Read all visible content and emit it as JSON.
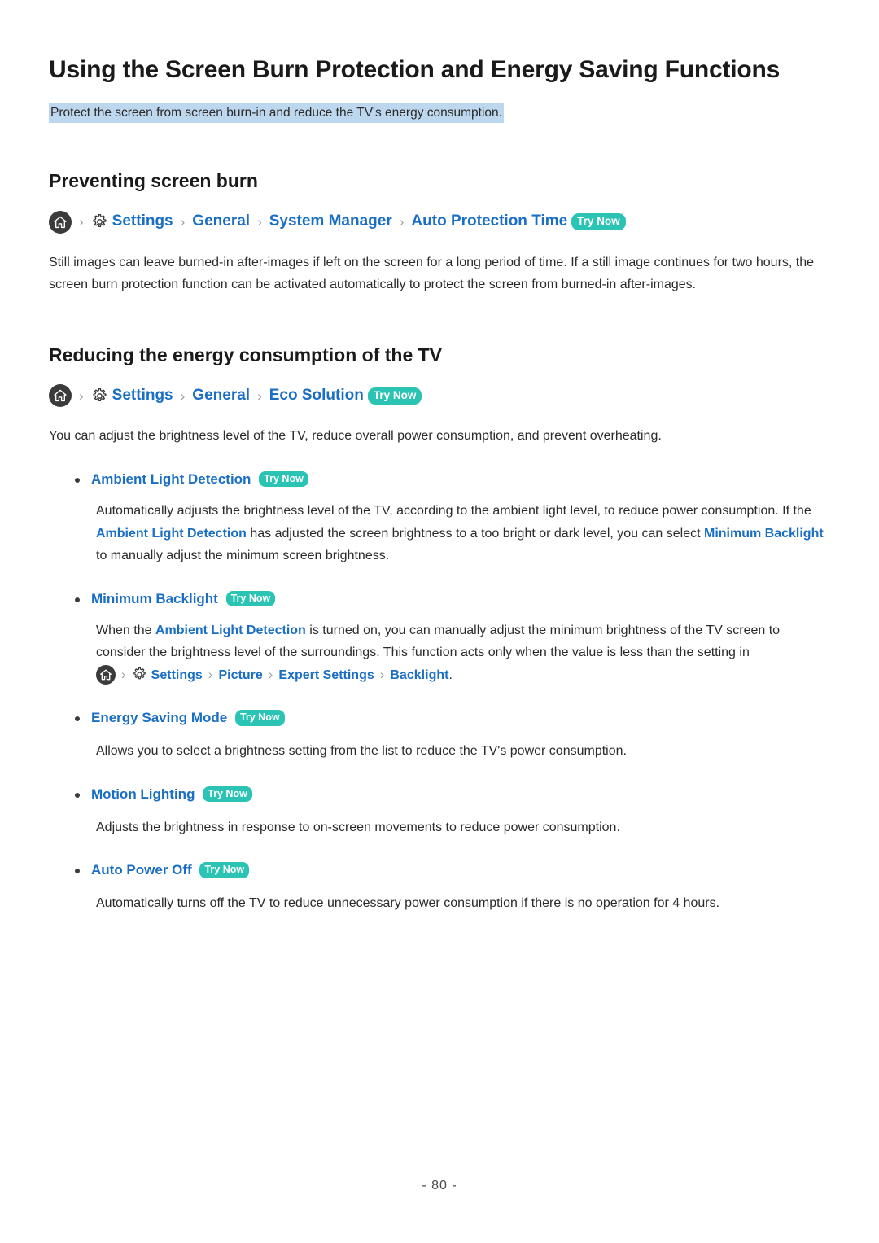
{
  "document": {
    "title": "Using the Screen Burn Protection and Energy Saving Functions",
    "subtitle": "Protect the screen from screen burn-in and reduce the TV's energy consumption.",
    "page_number": "- 80 -"
  },
  "colors": {
    "link_blue": "#1a6fc4",
    "try_now_teal": "#2bc4b4",
    "highlight_blue": "#bdd7ee",
    "icon_dark": "#3b3b3b",
    "body_text": "#2b2b2b"
  },
  "icons": {
    "home": "home-icon",
    "gear": "gear-icon",
    "chevron": "›",
    "bullet": "•"
  },
  "labels": {
    "try_now": "Try Now",
    "separator": "›"
  },
  "sections": [
    {
      "heading": "Preventing screen burn",
      "breadcrumb": {
        "items": [
          "Settings",
          "General",
          "System Manager",
          "Auto Protection Time"
        ],
        "badge": "Try Now"
      },
      "paragraph": "Still images can leave burned-in after-images if left on the screen for a long period of time. If a still image continues for two hours, the screen burn protection function can be activated automatically to protect the screen from burned-in after-images."
    },
    {
      "heading": "Reducing the energy consumption of the TV",
      "breadcrumb": {
        "items": [
          "Settings",
          "General",
          "Eco Solution"
        ],
        "badge": "Try Now"
      },
      "paragraph": "You can adjust the brightness level of the TV, reduce overall power consumption, and prevent overheating."
    }
  ],
  "bullets": [
    {
      "label": "Ambient Light Detection",
      "badge": "Try Now",
      "body_parts": {
        "p1": "Automatically adjusts the brightness level of the TV, according to the ambient light level, to reduce power consumption. If the ",
        "link1": "Ambient Light Detection",
        "p2": " has adjusted the screen brightness to a too bright or dark level, you can select ",
        "link2": "Minimum Backlight",
        "p3": " to manually adjust the minimum screen brightness."
      }
    },
    {
      "label": "Minimum Backlight",
      "badge": "Try Now",
      "body_parts": {
        "p1": "When the ",
        "link1": "Ambient Light Detection",
        "p2": " is turned on, you can manually adjust the minimum brightness of the TV screen to consider the brightness level of the surroundings. This function acts only when the value is less than the setting in ",
        "crumb": [
          "Settings",
          "Picture",
          "Expert Settings",
          "Backlight"
        ],
        "p3": "."
      }
    },
    {
      "label": "Energy Saving Mode",
      "badge": "Try Now",
      "body": "Allows you to select a brightness setting from the list to reduce the TV's power consumption."
    },
    {
      "label": "Motion Lighting",
      "badge": "Try Now",
      "body": "Adjusts the brightness in response to on-screen movements to reduce power consumption."
    },
    {
      "label": "Auto Power Off",
      "badge": "Try Now",
      "body": "Automatically turns off the TV to reduce unnecessary power consumption if there is no operation for 4 hours."
    }
  ]
}
